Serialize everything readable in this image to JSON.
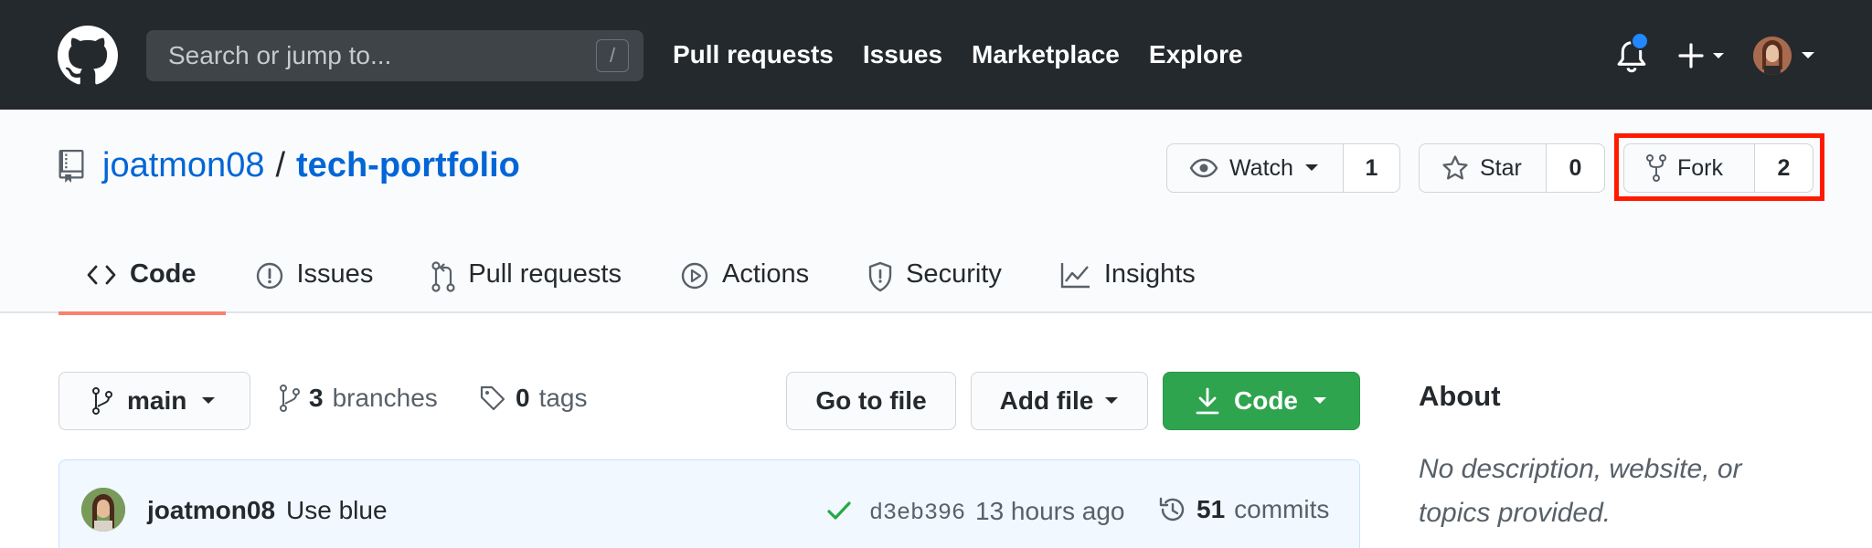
{
  "header": {
    "search_placeholder": "Search or jump to...",
    "search_shortcut": "/",
    "nav": [
      "Pull requests",
      "Issues",
      "Marketplace",
      "Explore"
    ],
    "notification_unread": true
  },
  "repo": {
    "owner": "joatmon08",
    "separator": "/",
    "name": "tech-portfolio",
    "watch_label": "Watch",
    "watch_count": "1",
    "star_label": "Star",
    "star_count": "0",
    "fork_label": "Fork",
    "fork_count": "2"
  },
  "tabs": [
    {
      "label": "Code",
      "active": true
    },
    {
      "label": "Issues",
      "active": false
    },
    {
      "label": "Pull requests",
      "active": false
    },
    {
      "label": "Actions",
      "active": false
    },
    {
      "label": "Security",
      "active": false
    },
    {
      "label": "Insights",
      "active": false
    }
  ],
  "toolbar": {
    "branch": "main",
    "branches_count": "3",
    "branches_label": "branches",
    "tags_count": "0",
    "tags_label": "tags",
    "goto_label": "Go to file",
    "addfile_label": "Add file",
    "code_label": "Code"
  },
  "commit": {
    "author": "joatmon08",
    "message": "Use blue",
    "sha": "d3eb396",
    "time": "13 hours ago",
    "count": "51",
    "count_label": "commits"
  },
  "about": {
    "title": "About",
    "description": "No description, website, or topics provided."
  },
  "colors": {
    "header_bg": "#24292e",
    "link": "#0366d6",
    "primary_green": "#2ea44f",
    "highlight": "#ff1a00",
    "active_tab_underline": "#f9826c"
  }
}
